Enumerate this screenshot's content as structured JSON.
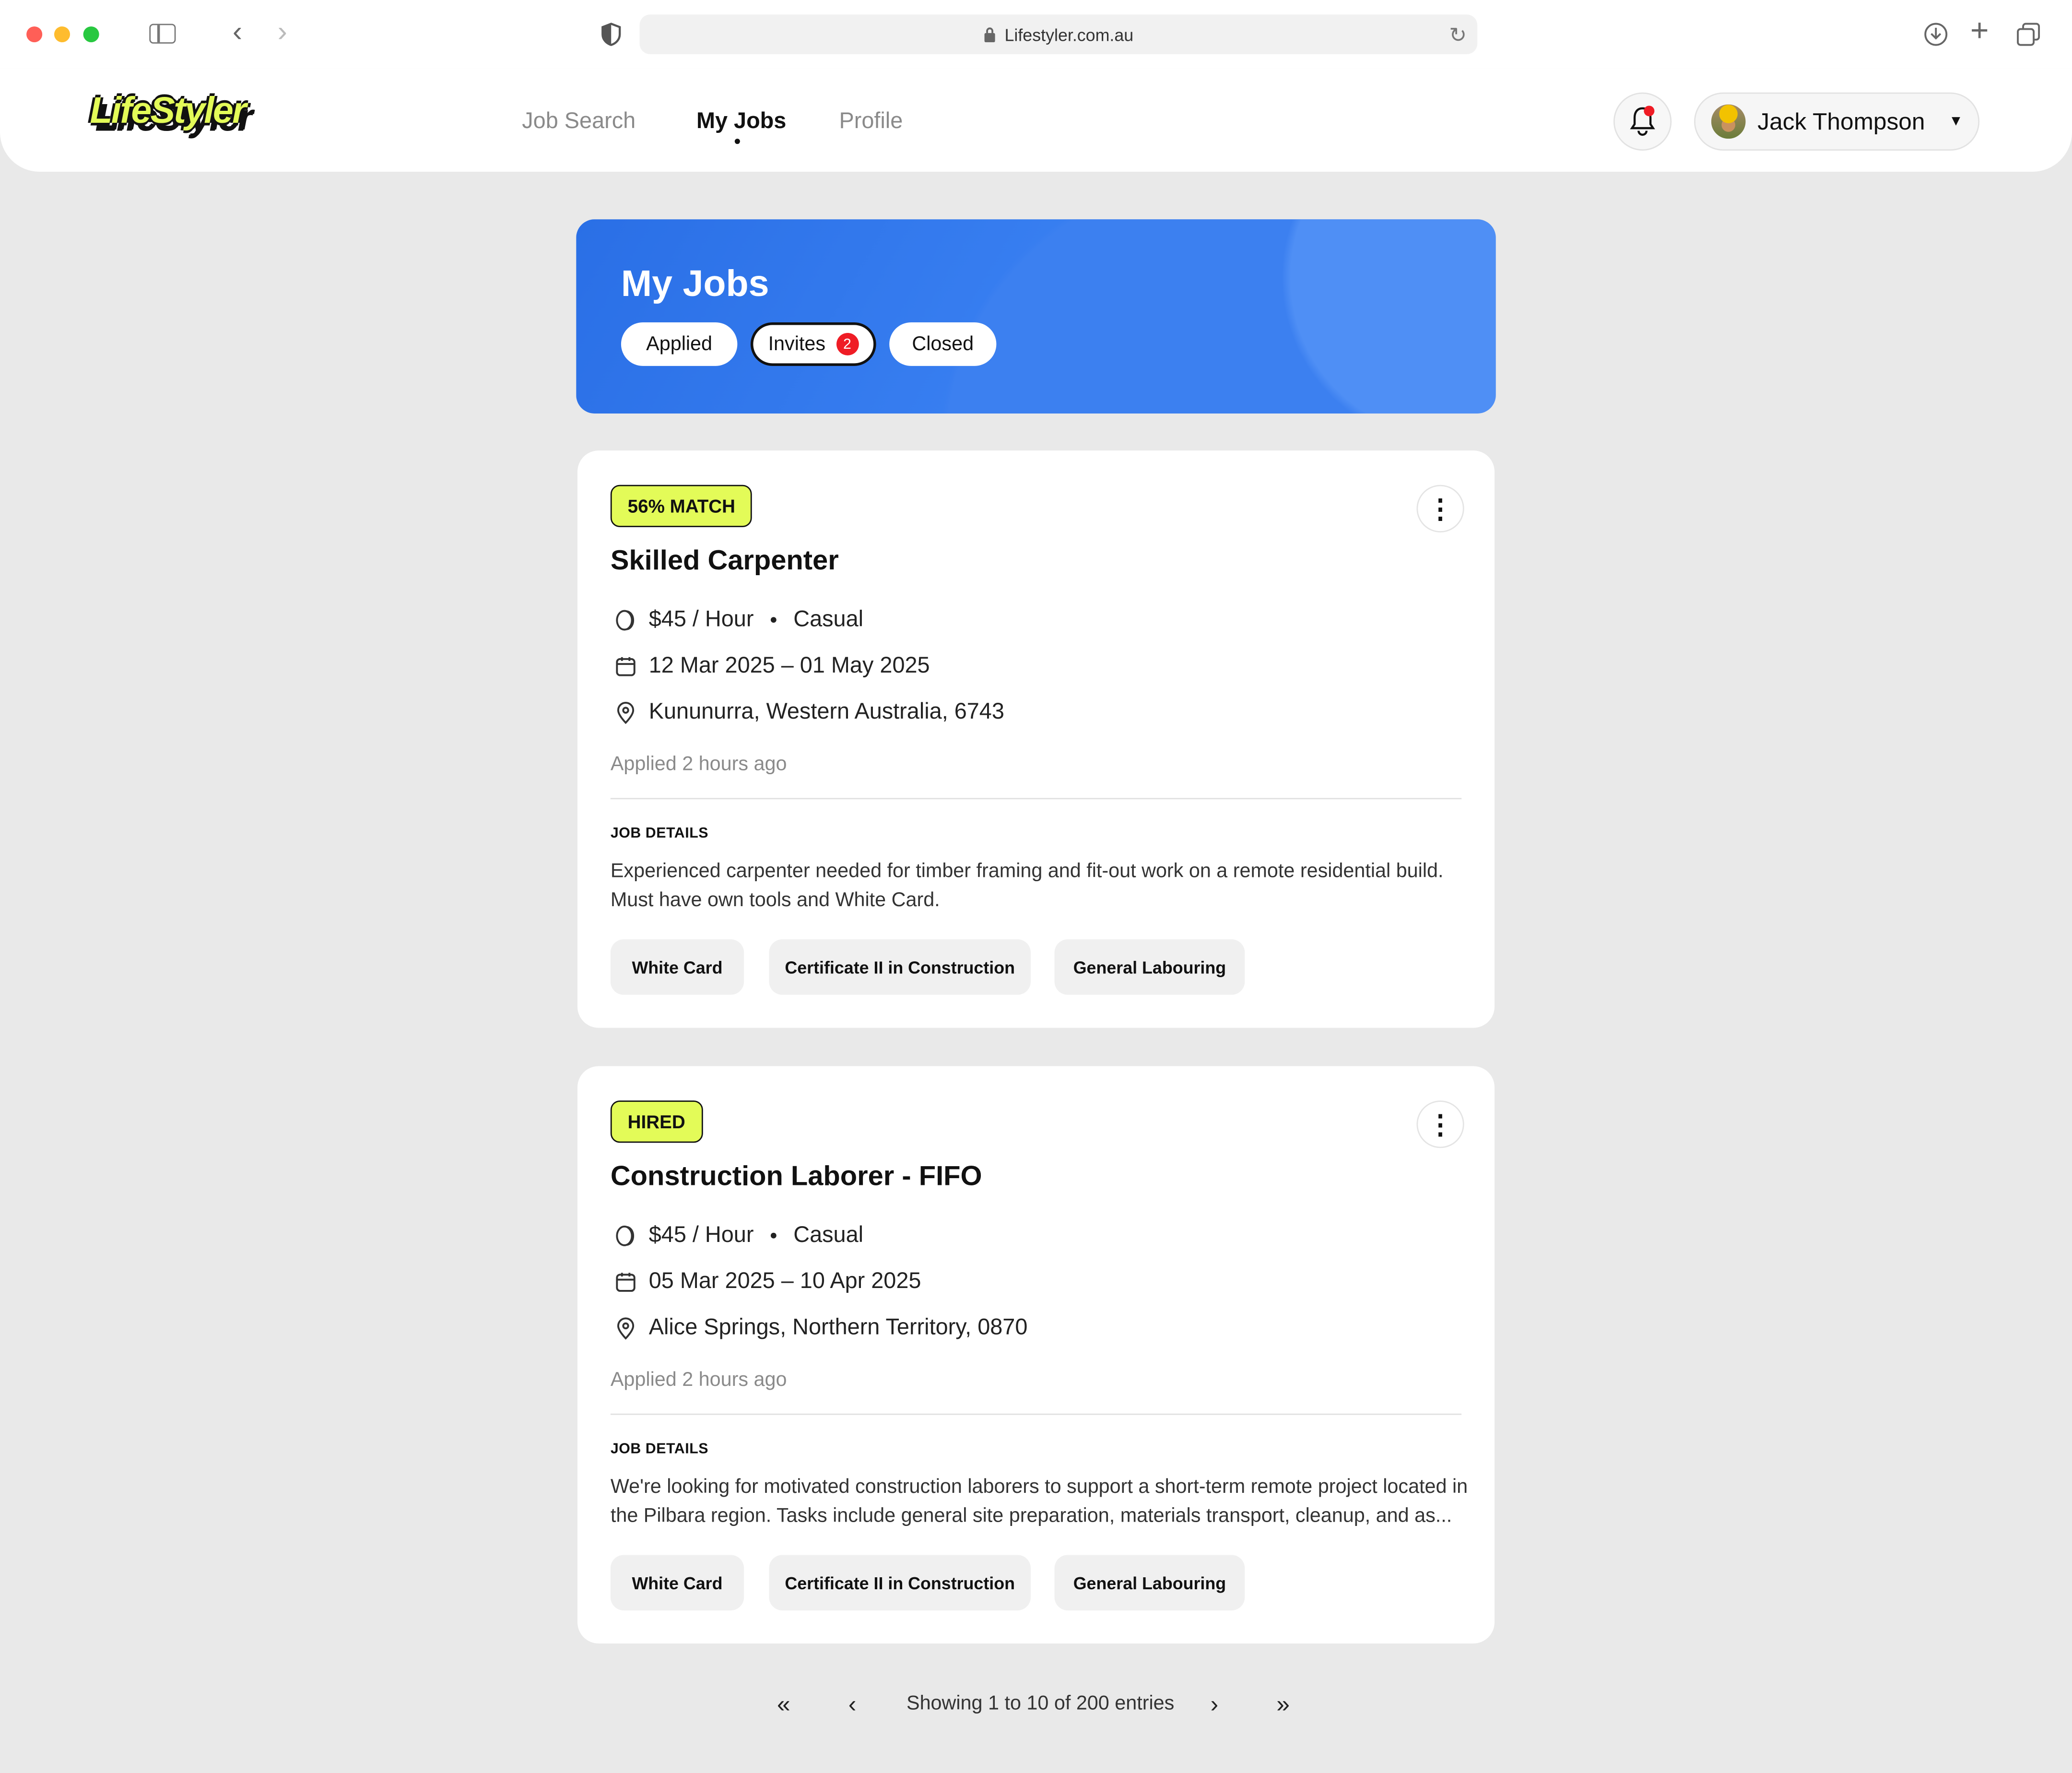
{
  "browser": {
    "url": "Lifestyler.com.au",
    "traffic_colors": [
      "#ff5f57",
      "#febc2e",
      "#28c840"
    ]
  },
  "header": {
    "logo_text": "LifeStyler",
    "nav": [
      {
        "label": "Job Search",
        "active": false
      },
      {
        "label": "My Jobs",
        "active": true
      },
      {
        "label": "Profile",
        "active": false
      }
    ],
    "user_name": "Jack Thompson",
    "has_notification": true
  },
  "banner": {
    "title": "My Jobs",
    "tabs": [
      {
        "label": "Applied"
      },
      {
        "label": "Invites",
        "count": "2",
        "selected": true
      },
      {
        "label": "Closed"
      }
    ]
  },
  "colors": {
    "accent": "#e3fb58",
    "banner": "#3b82f3",
    "notification": "#ef1c25"
  },
  "jobs": [
    {
      "badge": "56% MATCH",
      "title": "Skilled Carpenter",
      "pay": "$45 / Hour",
      "type": "Casual",
      "dates": "12 Mar 2025 – 01 May 2025",
      "location": "Kununurra, Western Australia, 6743",
      "applied": "Applied 2 hours ago",
      "details_label": "JOB DETAILS",
      "description": "Experienced carpenter needed for timber framing and fit-out work on a remote residential build. Must have own tools and White Card.",
      "chips": [
        "White Card",
        "Certificate II in Construction",
        "General Labouring"
      ]
    },
    {
      "badge": "HIRED",
      "title": "Construction Laborer - FIFO",
      "pay": "$45 / Hour",
      "type": "Casual",
      "dates": "05 Mar 2025 – 10 Apr 2025",
      "location": "Alice Springs, Northern Territory, 0870",
      "applied": "Applied 2 hours ago",
      "details_label": "JOB DETAILS",
      "description": "We're looking for motivated construction laborers to support a short-term remote project located in the Pilbara region. Tasks include general site preparation, materials transport, cleanup, and as...",
      "chips": [
        "White Card",
        "Certificate II in Construction",
        "General Labouring"
      ]
    }
  ],
  "pagination": {
    "first": "«",
    "prev": "‹",
    "text": "Showing 1 to 10 of 200 entries",
    "next": "›",
    "last": "»"
  }
}
